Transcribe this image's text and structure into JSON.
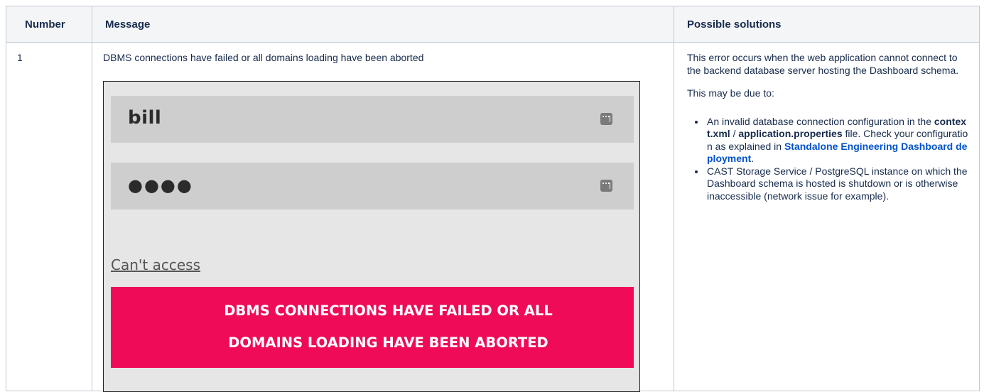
{
  "table": {
    "headers": {
      "number": "Number",
      "message": "Message",
      "solutions": "Possible solutions"
    },
    "row": {
      "number": "1",
      "message": "DBMS connections have failed or all domains loading have been aborted",
      "screenshot": {
        "username_value": "bill",
        "password_value": "●●●●",
        "cant_access_link": "Can't access",
        "error_line1": "DBMS CONNECTIONS HAVE FAILED OR ALL",
        "error_line2": "DOMAINS LOADING HAVE BEEN ABORTED",
        "error_color": "#ef0b57",
        "field_icon": "more-dots-icon"
      },
      "solutions": {
        "intro": "This error occurs when the web application cannot connect to the backend database server hosting the Dashboard schema.",
        "due_to": "This may be due to:",
        "item1_pre": "An invalid database connection configuration in the ",
        "item1_file1": "context.xml",
        "item1_sep": " / ",
        "item1_file2": "application.properties",
        "item1_mid": " file. Check your configuration as explained in ",
        "item1_link": "Standalone Engineering Dashboard deployment",
        "item1_end": ".",
        "item2": "CAST Storage Service / PostgreSQL instance on which the Dashboard schema is hosted is shutdown or is otherwise inaccessible (network issue for example)."
      }
    }
  }
}
